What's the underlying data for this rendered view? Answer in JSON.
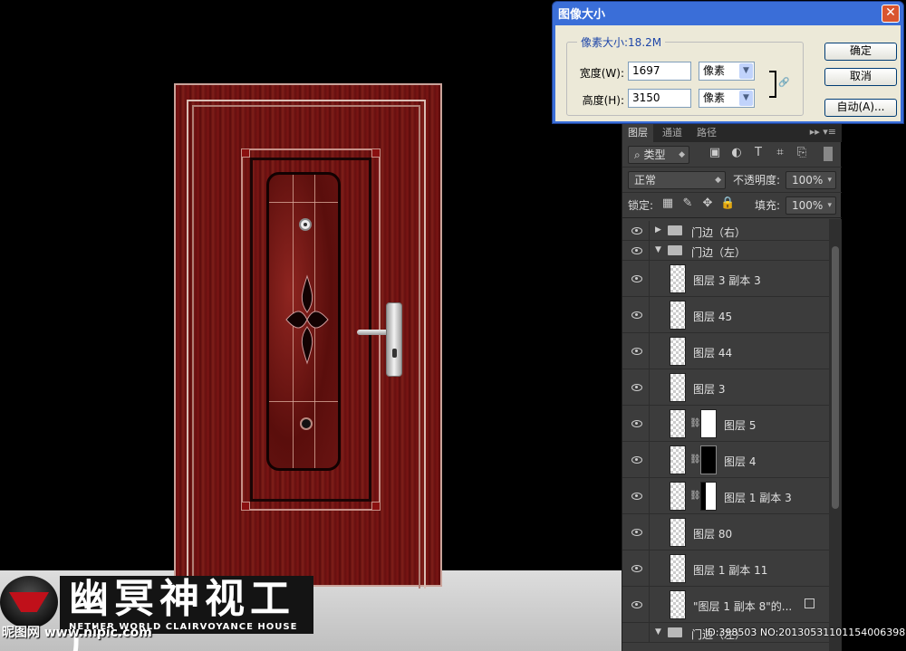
{
  "dialog": {
    "title": "图像大小",
    "close_label": "✕",
    "pixel_size_label": "像素大小:18.2M",
    "width_label": "宽度(W):",
    "width_value": "1697",
    "width_unit": "像素",
    "height_label": "高度(H):",
    "height_value": "3150",
    "height_unit": "像素",
    "ok_label": "确定",
    "cancel_label": "取消",
    "auto_label": "自动(A)..."
  },
  "layers_panel": {
    "tabs": [
      "图层",
      "通道",
      "路径"
    ],
    "filter_kind": "类型",
    "blend_mode": "正常",
    "opacity_label": "不透明度:",
    "opacity_value": "100%",
    "lock_label": "锁定:",
    "fill_label": "填充:",
    "fill_value": "100%",
    "rows": [
      {
        "type": "group-closed",
        "name": "门边（右）"
      },
      {
        "type": "group-open",
        "name": "门边（左）"
      },
      {
        "type": "layer",
        "name": "图层 3 副本 3"
      },
      {
        "type": "layer",
        "name": "图层 45"
      },
      {
        "type": "layer",
        "name": "图层 44"
      },
      {
        "type": "layer",
        "name": "图层 3"
      },
      {
        "type": "mask-white",
        "name": "图层 5"
      },
      {
        "type": "mask-black",
        "name": "图层 4"
      },
      {
        "type": "mask-split",
        "name": "图层 1 副本 3"
      },
      {
        "type": "layer",
        "name": "图层 80"
      },
      {
        "type": "layer",
        "name": "图层 1 副本 11"
      },
      {
        "type": "layer-fx",
        "name": "\"图层 1 副本 8\"的..."
      },
      {
        "type": "group-open",
        "name": "门边（左）"
      }
    ]
  },
  "logo": {
    "title": "幽冥神视工厂",
    "subtitle": "NETHER WORLD CLAIRVOYANCE HOUSE",
    "watermark": "昵图网 www.nipic.com"
  },
  "image_id": "ID:398503 NO:20130531101154006398"
}
